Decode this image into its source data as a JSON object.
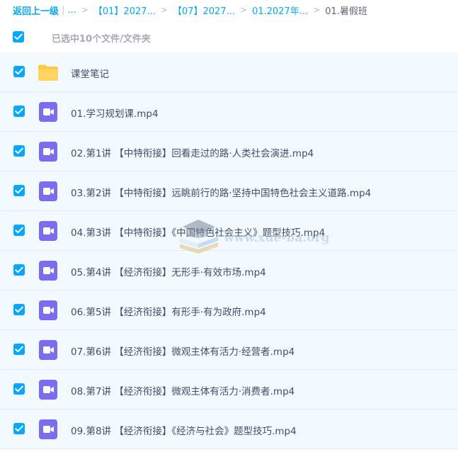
{
  "breadcrumb": {
    "back_label": "返回上一级",
    "ellipsis": "...",
    "items": [
      "【01】2027...",
      "【07】2027...",
      "01.2027年..."
    ],
    "current": "01.暑假班",
    "separator": ">",
    "pipe": "|"
  },
  "selection": {
    "summary": "已选中10个文件/文件夹"
  },
  "files": [
    {
      "name": "课堂笔记",
      "type": "folder",
      "checked": true
    },
    {
      "name": "01.学习规划课.mp4",
      "type": "video",
      "checked": true
    },
    {
      "name": "02.第1讲 【中特衔接】回看走过的路·人类社会演进.mp4",
      "type": "video",
      "checked": true
    },
    {
      "name": "03.第2讲 【中特衔接】远眺前行的路·坚持中国特色社会主义道路.mp4",
      "type": "video",
      "checked": true
    },
    {
      "name": "04.第3讲 【中特衔接】《中国特色社会主义》题型技巧.mp4",
      "type": "video",
      "checked": true
    },
    {
      "name": "05.第4讲 【经济衔接】无形手·有效市场.mp4",
      "type": "video",
      "checked": true
    },
    {
      "name": "06.第5讲 【经济衔接】有形手·有为政府.mp4",
      "type": "video",
      "checked": true
    },
    {
      "name": "07.第6讲 【经济衔接】微观主体有活力·经营者.mp4",
      "type": "video",
      "checked": true
    },
    {
      "name": "08.第7讲 【经济衔接】微观主体有活力·消费者.mp4",
      "type": "video",
      "checked": true
    },
    {
      "name": "09.第8讲 【经济衔接】《经济与社会》题型技巧.mp4",
      "type": "video",
      "checked": true
    }
  ],
  "watermark": {
    "text": "www.xue-ba.org"
  },
  "colors": {
    "accent": "#06a7ff",
    "row_bg": "#f2f9ff",
    "folder": "#ffc93f",
    "video": "#7b6cf0"
  }
}
